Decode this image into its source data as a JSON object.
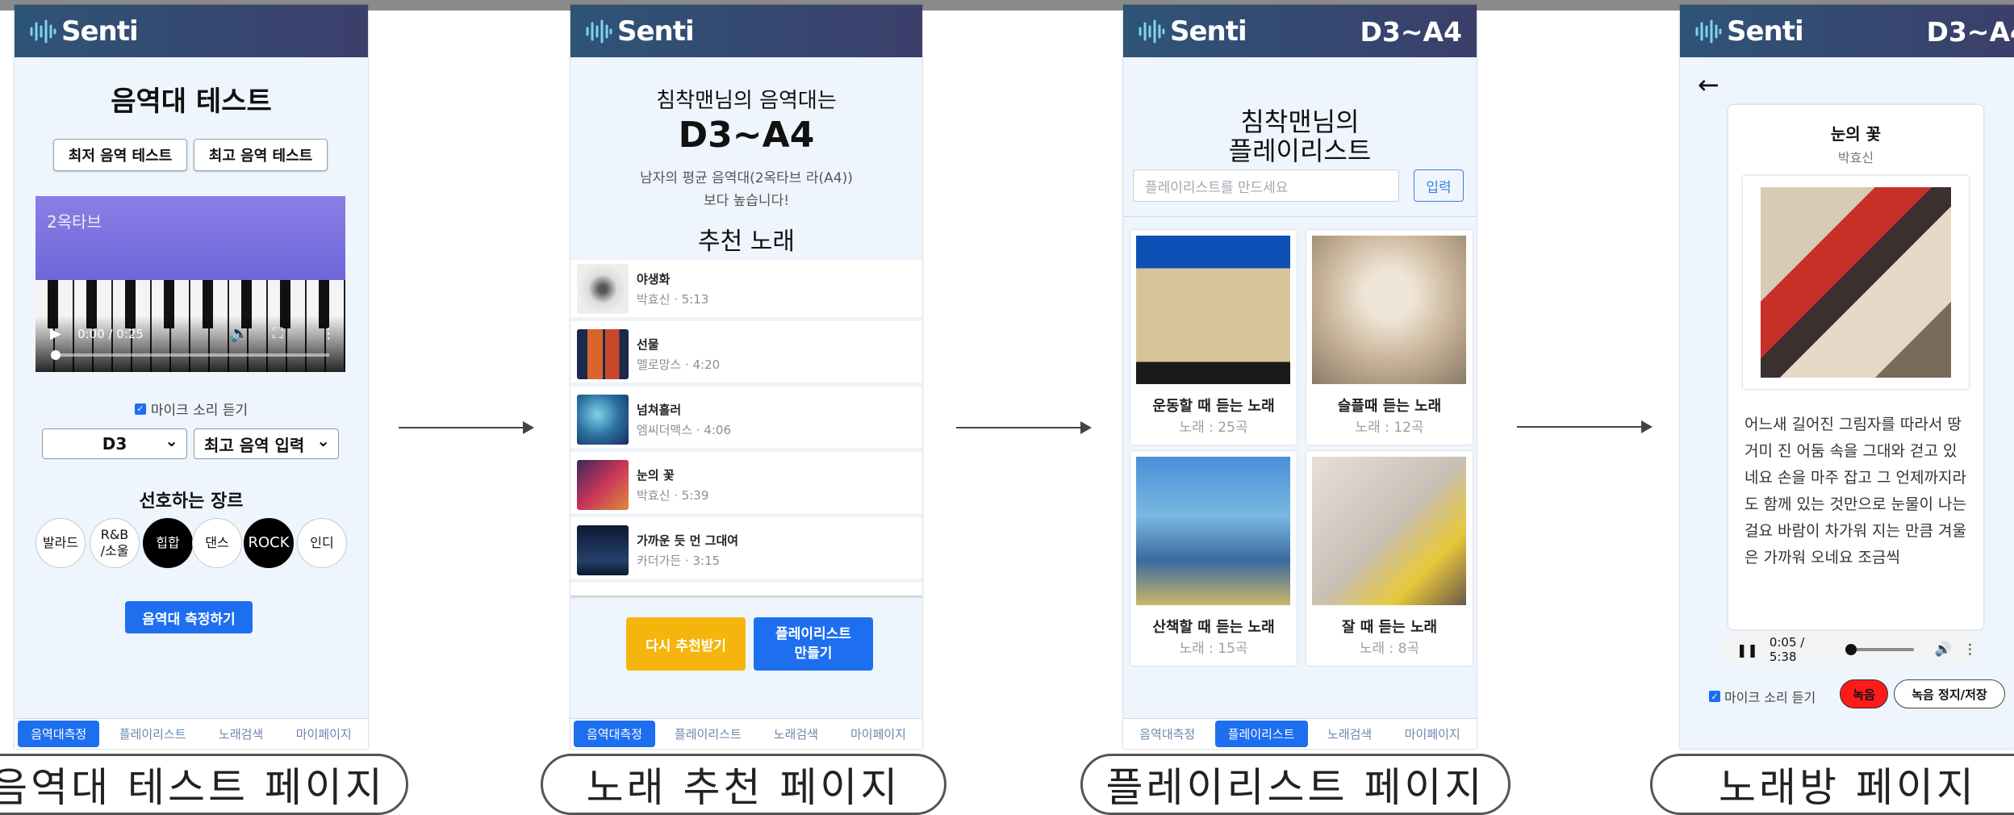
{
  "app": {
    "brand": "Senti",
    "range": "D3~A4"
  },
  "nav": [
    "음역대측정",
    "플레이리스트",
    "노래검색",
    "마이페이지"
  ],
  "captions": [
    "음역대 테스트 페이지",
    "노래 추천 페이지",
    "플레이리스트 페이지",
    "노래방 페이지"
  ],
  "page1": {
    "title": "음역대 테스트",
    "btn_low": "최저 음역 테스트",
    "btn_high": "최고 음역 테스트",
    "video_label": "2옥타브",
    "video_time": "0:00 / 0:25",
    "mic_label": "마이크 소리 듣기",
    "select_low": "D3",
    "select_high": "최고 음역 입력",
    "genre_title": "선호하는 장르",
    "genres": [
      "발라드",
      "R&B\n/소울",
      "힙합",
      "댄스",
      "ROCK",
      "인디"
    ],
    "submit": "음역대 측정하기"
  },
  "page2": {
    "line1": "침착맨님의 음역대는",
    "range": "D3~A4",
    "desc1": "남자의 평균 음역대(2옥타브 라(A4))",
    "desc2": "보다 높습니다!",
    "rec_title": "추천 노래",
    "songs": [
      {
        "title": "야생화",
        "sub": "박효신 · 5:13"
      },
      {
        "title": "선물",
        "sub": "멜로망스 · 4:20"
      },
      {
        "title": "넘쳐흘러",
        "sub": "엠씨더맥스 · 4:06"
      },
      {
        "title": "눈의 꽃",
        "sub": "박효신 · 5:39"
      },
      {
        "title": "가까운 듯 먼 그대여",
        "sub": "카더가든 · 3:15"
      }
    ],
    "btn_retry": "다시 추천받기",
    "btn_playlist": "플레이리스트\n만들기"
  },
  "page3": {
    "title1": "침착맨님의",
    "title2": "플레이리스트",
    "placeholder": "플레이리스트를 만드세요",
    "input_btn": "입력",
    "cards": [
      {
        "title": "운동할 때 듣는 노래",
        "count": "노래 : 25곡"
      },
      {
        "title": "슬플때 듣는 노래",
        "count": "노래 : 12곡"
      },
      {
        "title": "산책할 때 듣는 노래",
        "count": "노래 : 15곡"
      },
      {
        "title": "잘 때 듣는 노래",
        "count": "노래 : 8곡"
      }
    ]
  },
  "page4": {
    "back": "←",
    "song": "눈의 꽃",
    "artist": "박효신",
    "lyrics": "어느새 길어진 그림자를 따라서 땅거미 진 어둠 속을 그대와 걷고 있네요 손을 마주 잡고 그 언제까지라도 함께 있는 것만으로 눈물이 나는 걸요 바람이 차가워 지는 만큼 겨울은 가까워 오네요 조금씩",
    "time": "0:05 / 5:38",
    "progress": 0.015,
    "mic_label": "마이크 소리 듣기",
    "rec": "녹음",
    "stop": "녹음 정지/저장"
  },
  "colors": {
    "header": "#35486f",
    "primary": "#1e6ef0",
    "yellow": "#f5b50c",
    "rec": "#ff1a1a"
  }
}
